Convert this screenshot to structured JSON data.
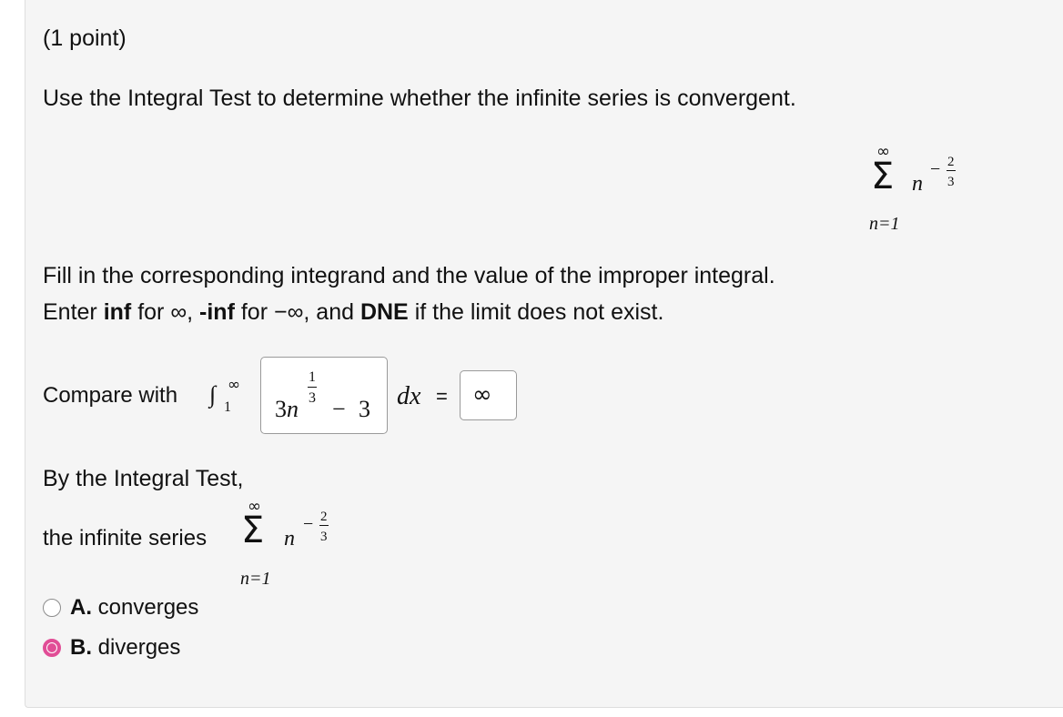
{
  "header": {
    "points": "(1 point)"
  },
  "problem": {
    "instruction": "Use the Integral Test to determine whether the infinite series is convergent.",
    "series": {
      "sum_upper": "∞",
      "sum_symbol": "Σ",
      "sum_lower": "n=1",
      "base": "n",
      "exponent_sign": "−",
      "exponent_num": "2",
      "exponent_den": "3"
    }
  },
  "fill_in": {
    "line1": "Fill in the corresponding integrand and the value of the improper integral.",
    "line2_parts": {
      "enter": "Enter ",
      "inf": "inf",
      "for_inf": " for ∞, ",
      "neg_inf": "-inf",
      "for_neg_inf": " for −∞, and ",
      "dne": "DNE",
      "rest": " if the limit does not exist."
    }
  },
  "compare": {
    "label": "Compare with",
    "integral_symbol": "∫",
    "upper_limit": "∞",
    "lower_limit": "1",
    "integrand": {
      "coef": "3",
      "var": "n",
      "exp_num": "1",
      "exp_den": "3",
      "minus": "−",
      "constant": "3"
    },
    "dx": "dx",
    "equals": "=",
    "value": "∞"
  },
  "conclusion": {
    "by_test": "By the Integral Test,",
    "series_label": "the infinite series",
    "series": {
      "sum_upper": "∞",
      "sum_symbol": "Σ",
      "sum_lower": "n=1",
      "base": "n",
      "exponent_sign": "−",
      "exponent_num": "2",
      "exponent_den": "3"
    }
  },
  "options": [
    {
      "letter": "A.",
      "label": " converges",
      "selected": false
    },
    {
      "letter": "B.",
      "label": " diverges",
      "selected": true
    }
  ],
  "colors": {
    "panel_bg": "#f5f5f5",
    "radio_selected": "#e14d96"
  }
}
